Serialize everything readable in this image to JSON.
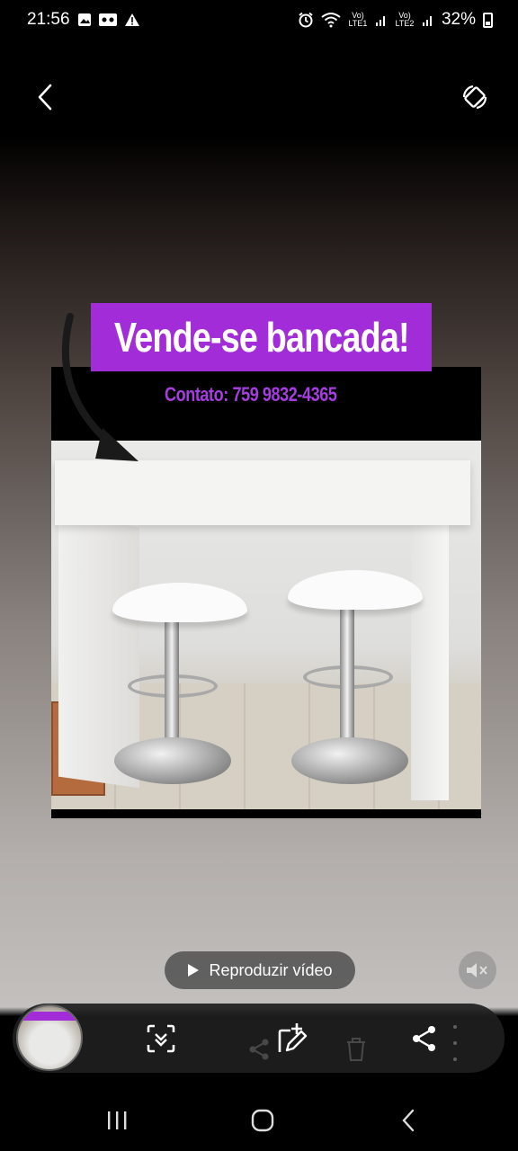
{
  "status_bar": {
    "time": "21:56",
    "sim1_label": "Vo) LTE1",
    "sim2_label": "Vo) LTE2",
    "battery": "32%",
    "icons": [
      "gallery-icon",
      "voicemail-icon",
      "warning-icon",
      "alarm-icon",
      "wifi-icon",
      "signal-icon",
      "battery-icon"
    ]
  },
  "top_bar": {
    "back_icon": "back-arrow-icon",
    "rotate_icon": "auto-rotate-icon"
  },
  "media": {
    "banner_text": "Vende-se bancada!",
    "contact_text": "Contato: 759 9832-4365",
    "banner_color": "#a22dd8",
    "contact_color": "#a53de0"
  },
  "playback": {
    "play_label": "Reproduzir vídeo",
    "mute_icon": "mute-icon"
  },
  "action_bar": {
    "items": [
      "thumbnail",
      "scan-icon",
      "edit-icon",
      "share-icon",
      "delete-icon",
      "more-icon"
    ]
  },
  "nav_bar": {
    "items": [
      "recents-icon",
      "home-icon",
      "back-icon"
    ]
  }
}
